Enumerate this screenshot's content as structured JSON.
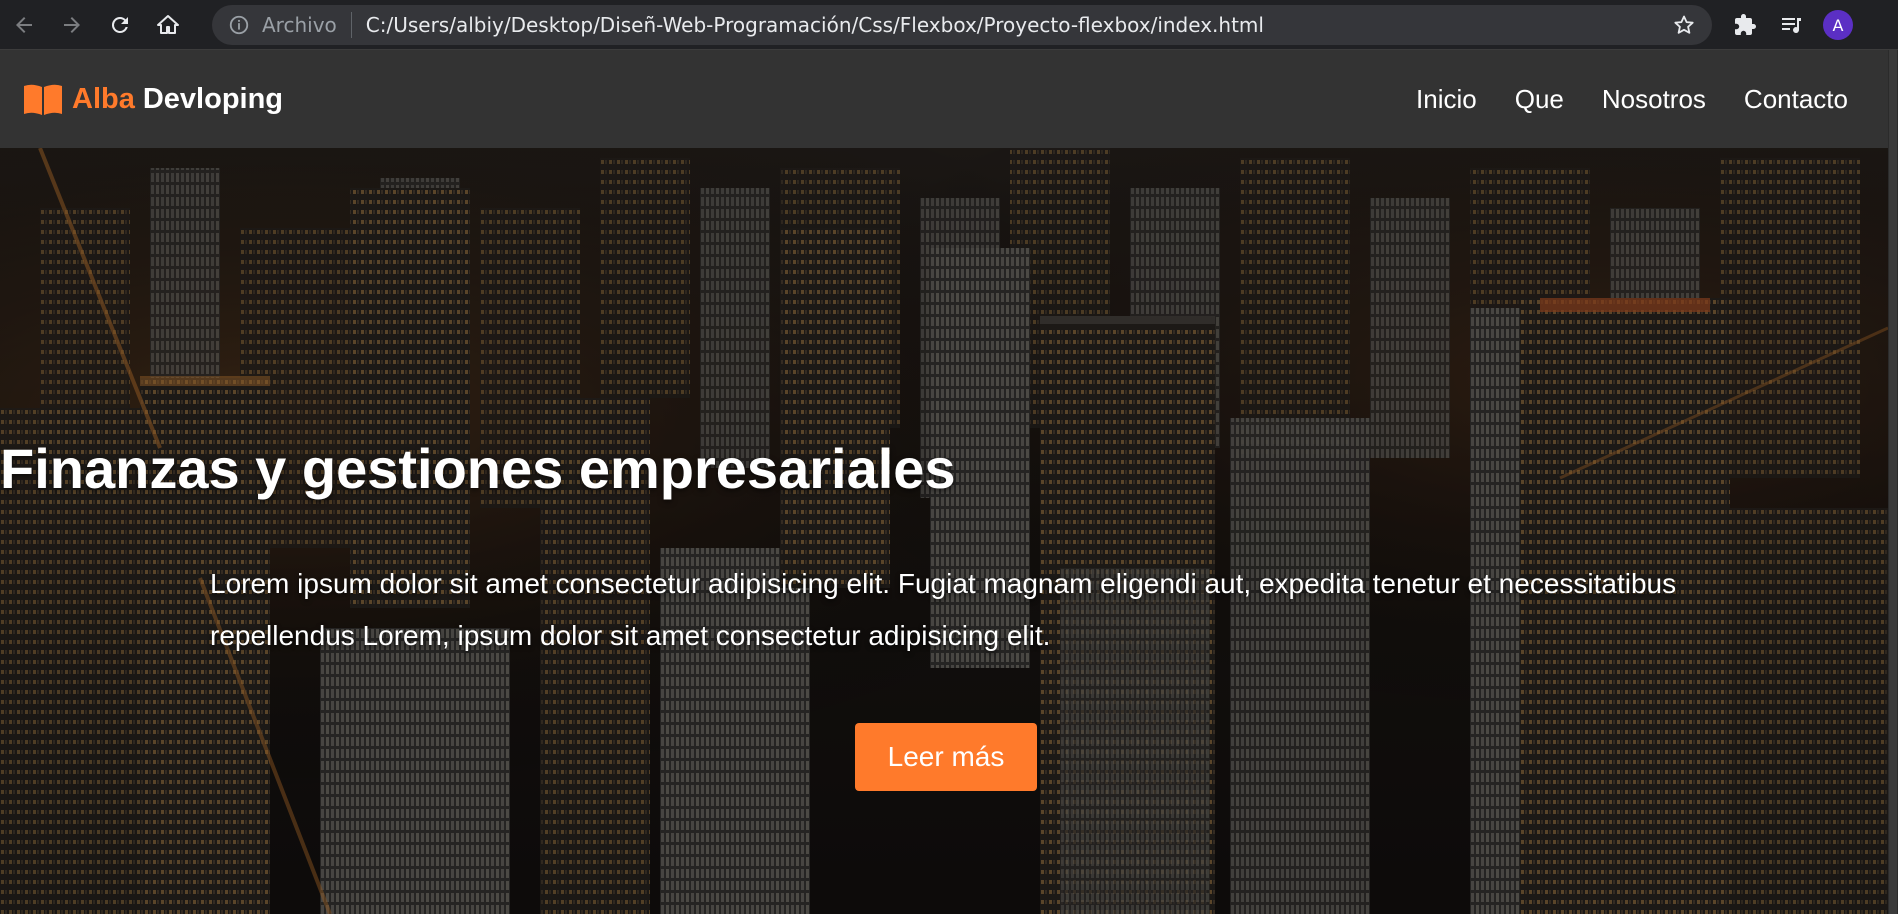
{
  "browser": {
    "omnibox_label": "Archivo",
    "url": "C:/Users/albiy/Desktop/Diseñ-Web-Programación/Css/Flexbox/Proyecto-flexbox/index.html",
    "profile_initial": "A",
    "icons": {
      "back": "arrow-left-icon",
      "forward": "arrow-right-icon",
      "reload": "reload-icon",
      "home": "home-icon",
      "info": "info-icon",
      "bookmark": "star-icon",
      "extensions": "puzzle-icon",
      "media": "playlist-icon"
    }
  },
  "header": {
    "logo_accent": "Alba",
    "logo_main": "Devloping",
    "logo_icon": "book-icon",
    "nav": [
      "Inicio",
      "Que",
      "Nosotros",
      "Contacto"
    ]
  },
  "hero": {
    "title": "Finanzas y gestiones empresariales",
    "text": "Lorem ipsum dolor sit amet consectetur adipisicing elit. Fugiat magnam eligendi aut, expedita tenetur et necessitatibus repellendus Lorem, ipsum dolor sit amet consectetur adipisicing elit.",
    "button_label": "Leer más"
  },
  "colors": {
    "accent": "#ff7a2b",
    "header_bg": "#333333",
    "browser_bg": "#202124",
    "avatar": "#5b2fc4"
  }
}
